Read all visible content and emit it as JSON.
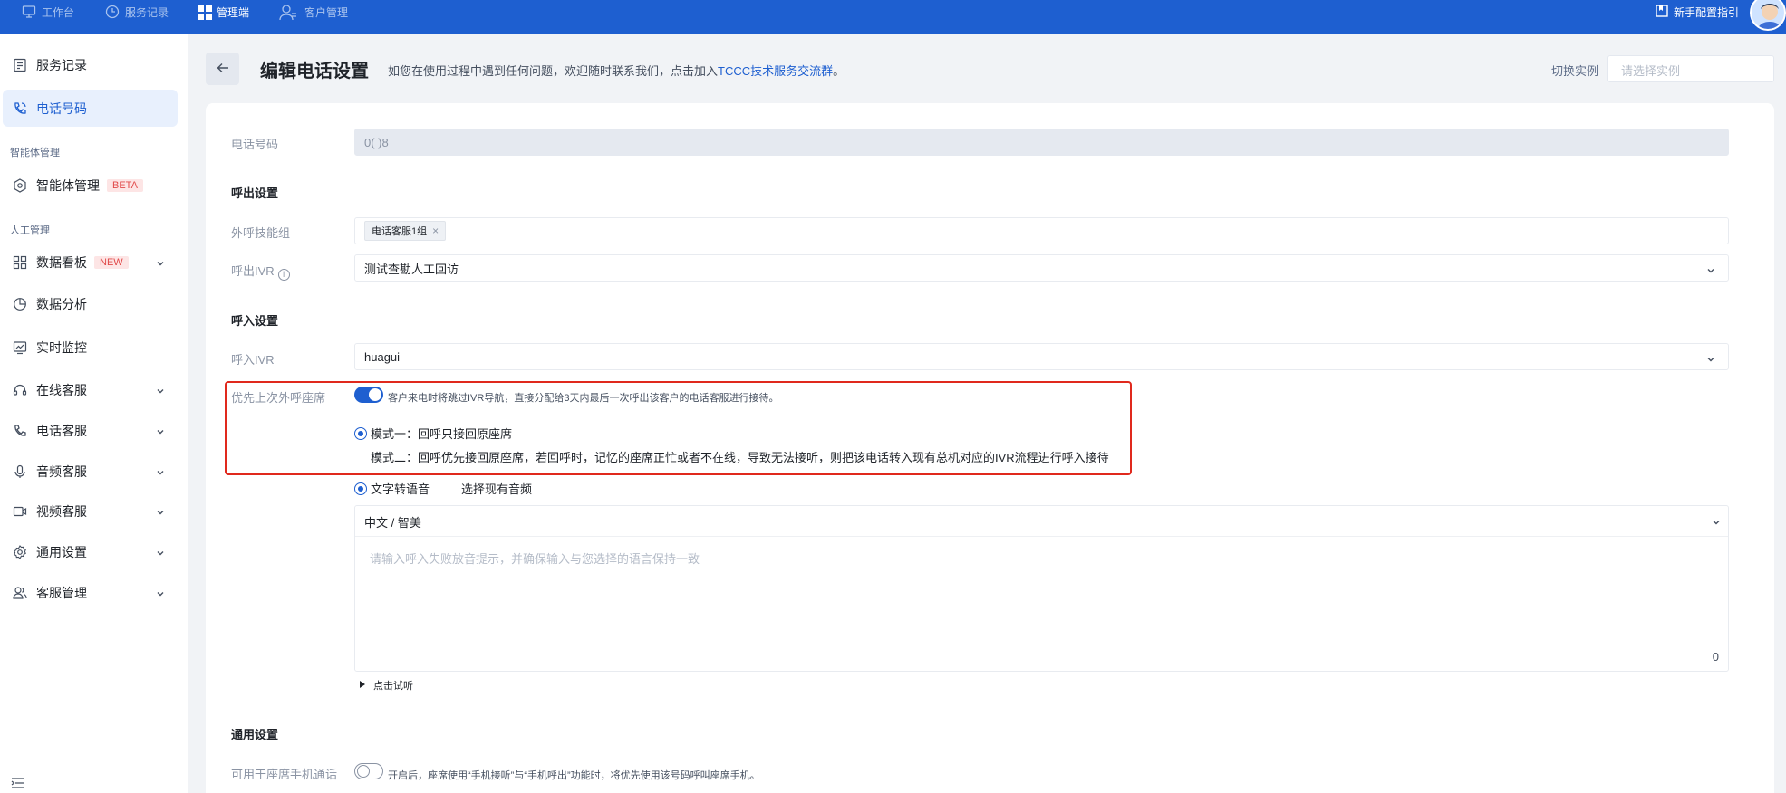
{
  "topbar": {
    "nav": [
      {
        "label": "工作台",
        "icon": "monitor-icon"
      },
      {
        "label": "服务记录",
        "icon": "clock-icon"
      },
      {
        "label": "管理端",
        "icon": "grid-icon"
      },
      {
        "label": "客户管理",
        "icon": "user-icon"
      }
    ],
    "guide_label": "新手配置指引"
  },
  "sidebar": {
    "items": [
      {
        "label": "服务记录",
        "icon": "document-icon"
      },
      {
        "label": "电话号码",
        "icon": "phone-icon"
      },
      {
        "label": "智能体管理",
        "icon": "hexagon-icon",
        "tag": "BETA"
      },
      {
        "label": "数据看板",
        "icon": "dashboard-icon",
        "tag": "NEW"
      },
      {
        "label": "数据分析",
        "icon": "pie-icon"
      },
      {
        "label": "实时监控",
        "icon": "monitor-chart-icon"
      },
      {
        "label": "在线客服",
        "icon": "headset-icon"
      },
      {
        "label": "电话客服",
        "icon": "phone-icon"
      },
      {
        "label": "音频客服",
        "icon": "mic-icon"
      },
      {
        "label": "视频客服",
        "icon": "video-icon"
      },
      {
        "label": "通用设置",
        "icon": "gear-icon"
      },
      {
        "label": "客服管理",
        "icon": "users-icon"
      }
    ],
    "sections": {
      "ai": "智能体管理",
      "human": "人工管理"
    }
  },
  "header": {
    "title": "编辑电话设置",
    "hint_prefix": "如您在使用过程中遇到任何问题，欢迎随时联系我们，点击加入",
    "hint_link": "TCCC技术服务交流群",
    "hint_suffix": "。",
    "instance_label": "切换实例",
    "instance_placeholder": "请选择实例"
  },
  "form": {
    "phone_label": "电话号码",
    "phone_value": "0(          )8",
    "outbound_section": "呼出设置",
    "outbound_group_label": "外呼技能组",
    "outbound_group_chip": "电话客服1组",
    "outbound_ivr_label": "呼出IVR",
    "outbound_ivr_value": "测试查勘人工回访",
    "inbound_section": "呼入设置",
    "inbound_ivr_label": "呼入IVR",
    "inbound_ivr_value": "huagui",
    "priority_label": "优先上次外呼座席",
    "priority_desc": "客户来电时将跳过IVR导航，直接分配给3天内最后一次呼出该客户的电话客服进行接待。",
    "mode1": "模式一：回呼只接回原座席",
    "mode2": "模式二：回呼优先接回原座席，若回呼时，记忆的座席正忙或者不在线，导致无法接听，则把该电话转入现有总机对应的IVR流程进行呼入接待",
    "tts_label": "文字转语音",
    "audio_label": "选择现有音频",
    "voice_value": "中文 / 智美",
    "text_placeholder": "请输入呼入失败放音提示，并确保输入与您选择的语言保持一致",
    "char_count": "0",
    "trial_label": "点击试听",
    "general_section": "通用设置",
    "mobile_label": "可用于座席手机通话",
    "mobile_desc": "开启后，座席使用“手机接听”与“手机呼出”功能时，将优先使用该号码呼叫座席手机。"
  },
  "colors": {
    "brand": "#1e5fd0",
    "highlight": "#e0291d"
  }
}
